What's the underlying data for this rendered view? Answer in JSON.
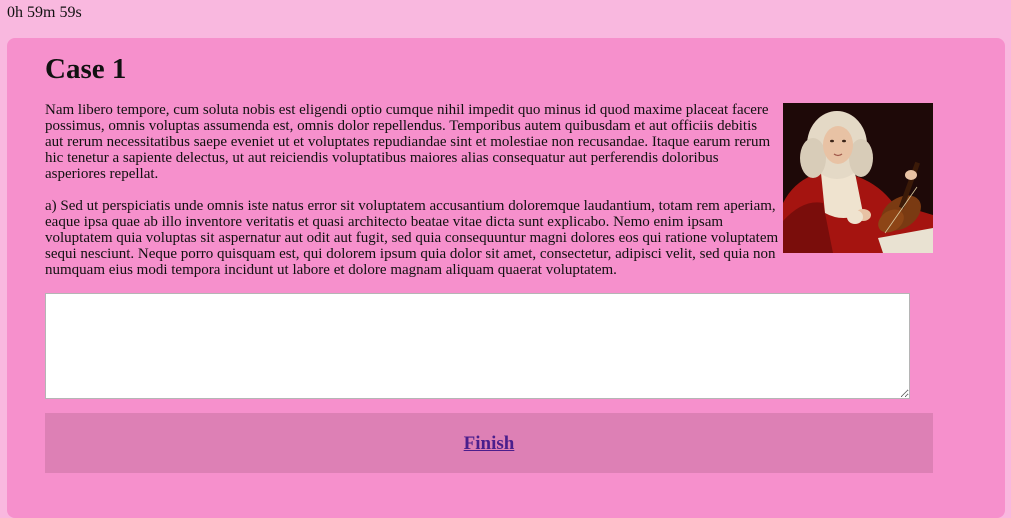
{
  "timer": "0h 59m 59s",
  "case": {
    "title": "Case 1",
    "paragraph1": "Nam libero tempore, cum soluta nobis est eligendi optio cumque nihil impedit quo minus id quod maxime placeat facere possimus, omnis voluptas assumenda est, omnis dolor repellendus. Temporibus autem quibusdam et aut officiis debitis aut rerum necessitatibus saepe eveniet ut et voluptates repudiandae sint et molestiae non recusandae. Itaque earum rerum hic tenetur a sapiente delectus, ut aut reiciendis voluptatibus maiores alias consequatur aut perferendis doloribus asperiores repellat.",
    "paragraph2": "a) Sed ut perspiciatis unde omnis iste natus error sit voluptatem accusantium doloremque laudantium, totam rem aperiam, eaque ipsa quae ab illo inventore veritatis et quasi architecto beatae vitae dicta sunt explicabo. Nemo enim ipsam voluptatem quia voluptas sit aspernatur aut odit aut fugit, sed quia consequuntur magni dolores eos qui ratione voluptatem sequi nesciunt. Neque porro quisquam est, qui dolorem ipsum quia dolor sit amet, consectetur, adipisci velit, sed quia non numquam eius modi tempora incidunt ut labore et dolore magnam aliquam quaerat voluptatem.",
    "image_icon": "portrait-violinist-image"
  },
  "answer": {
    "value": "",
    "placeholder": ""
  },
  "finish_label": "Finish",
  "colors": {
    "page_background": "#f9b8df",
    "card_background": "#f690cc",
    "finish_bar": "#dd80b5",
    "link": "#4a1e8c"
  }
}
